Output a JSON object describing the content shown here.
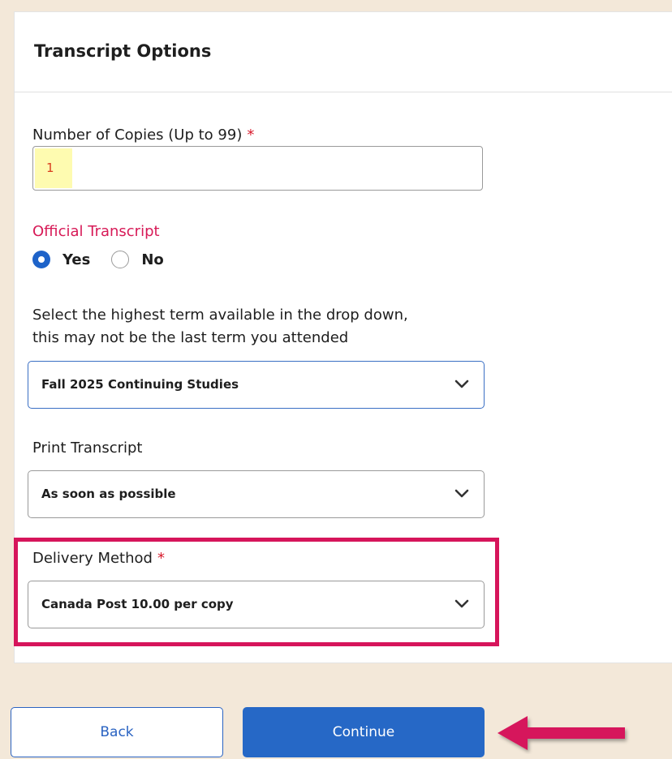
{
  "panel": {
    "title": "Transcript Options"
  },
  "copies": {
    "label": "Number of Copies (Up to 99)",
    "required_mark": "*",
    "value": "1"
  },
  "official": {
    "label": "Official Transcript",
    "options": [
      {
        "label": "Yes",
        "checked": true
      },
      {
        "label": "No",
        "checked": false
      }
    ]
  },
  "term": {
    "help_line1": "Select the highest term available in the drop down,",
    "help_line2": "this may not be the last term you attended",
    "selected": "Fall 2025 Continuing Studies"
  },
  "print": {
    "label": "Print Transcript",
    "selected": "As soon as possible"
  },
  "delivery": {
    "label": "Delivery Method",
    "required_mark": "*",
    "selected": "Canada Post 10.00 per copy"
  },
  "buttons": {
    "back": "Back",
    "continue": "Continue"
  },
  "icons": {
    "dropdown": "chevron-down-icon",
    "callout": "arrow-left-icon"
  },
  "colors": {
    "accent": "#2668c6",
    "highlight": "#d6155b",
    "required": "#d71a2c",
    "background": "#f3e8d9"
  }
}
